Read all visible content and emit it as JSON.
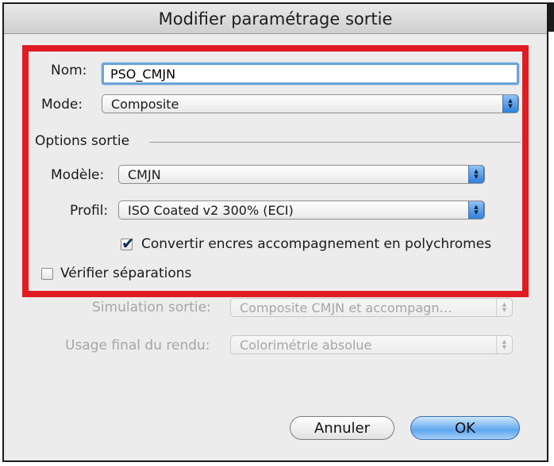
{
  "window": {
    "title": "Modifier paramétrage sortie"
  },
  "form": {
    "name_label": "Nom:",
    "name_value": "PSO_CMJN",
    "mode_label": "Mode:",
    "mode_value": "Composite",
    "options_heading": "Options sortie",
    "model_label": "Modèle:",
    "model_value": "CMJN",
    "profile_label": "Profil:",
    "profile_value": "ISO Coated v2 300% (ECI)",
    "convert_label": "Convertir encres accompagnement en polychromes",
    "convert_checked": true,
    "verify_label": "Vérifier séparations",
    "verify_checked": false,
    "simulation_label": "Simulation sortie:",
    "simulation_value": "Composite CMJN et accompagn…",
    "rendering_label": "Usage final du rendu:",
    "rendering_value": "Colorimétrie absolue"
  },
  "buttons": {
    "cancel_label": "Annuler",
    "ok_label": "OK"
  },
  "colors": {
    "highlight_frame": "#e01b22",
    "default_button": "#5fa6ee",
    "focus_ring": "#6aa3d9"
  }
}
